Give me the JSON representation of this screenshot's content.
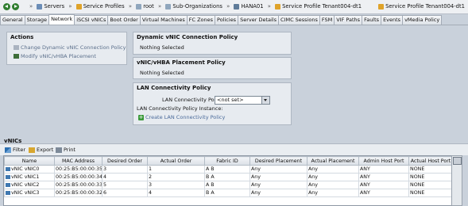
{
  "breadcrumb": {
    "items": [
      {
        "label": "Servers",
        "icon": "server-icon"
      },
      {
        "label": "Service Profiles",
        "icon": "service-profile-icon"
      },
      {
        "label": "root",
        "icon": "org-icon"
      },
      {
        "label": "Sub-Organizations",
        "icon": "org-icon"
      },
      {
        "label": "HANA01",
        "icon": "org-icon"
      },
      {
        "label": "Service Profile Tenant004-dt1",
        "icon": "service-profile-icon"
      }
    ],
    "right_title": "Service Profile Tenant004-dt1",
    "separator": "»"
  },
  "tabs": [
    {
      "label": "General",
      "active": false
    },
    {
      "label": "Storage",
      "active": false
    },
    {
      "label": "Network",
      "active": true
    },
    {
      "label": "iSCSI vNICs",
      "active": false
    },
    {
      "label": "Boot Order",
      "active": false
    },
    {
      "label": "Virtual Machines",
      "active": false
    },
    {
      "label": "FC Zones",
      "active": false
    },
    {
      "label": "Policies",
      "active": false
    },
    {
      "label": "Server Details",
      "active": false
    },
    {
      "label": "CIMC Sessions",
      "active": false
    },
    {
      "label": "FSM",
      "active": false
    },
    {
      "label": "VIF Paths",
      "active": false
    },
    {
      "label": "Faults",
      "active": false
    },
    {
      "label": "Events",
      "active": false
    },
    {
      "label": "vMedia Policy",
      "active": false
    }
  ],
  "actions": {
    "title": "Actions",
    "change_dynamic": "Change Dynamic vNIC Connection Policy",
    "modify_placement": "Modify vNIC/vHBA Placement"
  },
  "dynamic_policy": {
    "title": "Dynamic vNIC Connection Policy",
    "value": "Nothing Selected"
  },
  "placement_policy": {
    "title": "vNIC/vHBA Placement Policy",
    "value": "Nothing Selected"
  },
  "lan_policy": {
    "title": "LAN Connectivity Policy",
    "select_label": "LAN Connectivity Policy:",
    "select_value": "<not set>",
    "instance_label": "LAN Connectivity Policy Instance:",
    "create_link": "Create LAN Connectivity Policy"
  },
  "vnics": {
    "title": "vNICs",
    "toolbar": {
      "filter": "Filter",
      "export": "Export",
      "print": "Print"
    },
    "columns": [
      "Name",
      "MAC Address",
      "Desired Order",
      "Actual Order",
      "Fabric ID",
      "Desired Placement",
      "Actual Placement",
      "Admin Host Port",
      "Actual Host Port"
    ],
    "rows": [
      [
        "vNIC vNIC0",
        "00:25:B5:00:00:35",
        "3",
        "1",
        "A B",
        "Any",
        "Any",
        "ANY",
        "NONE"
      ],
      [
        "vNIC vNIC1",
        "00:25:B5:00:00:34",
        "4",
        "2",
        "B A",
        "Any",
        "Any",
        "ANY",
        "NONE"
      ],
      [
        "vNIC vNIC2",
        "00:25:B5:00:00:33",
        "5",
        "3",
        "A B",
        "Any",
        "Any",
        "ANY",
        "NONE"
      ],
      [
        "vNIC vNIC3",
        "00:25:B5:00:00:32",
        "6",
        "4",
        "B A",
        "Any",
        "Any",
        "ANY",
        "NONE"
      ]
    ]
  },
  "colors": {
    "background": "#c9d1db",
    "link": "#4a6a9a",
    "accent_green": "#3b9a3b"
  }
}
